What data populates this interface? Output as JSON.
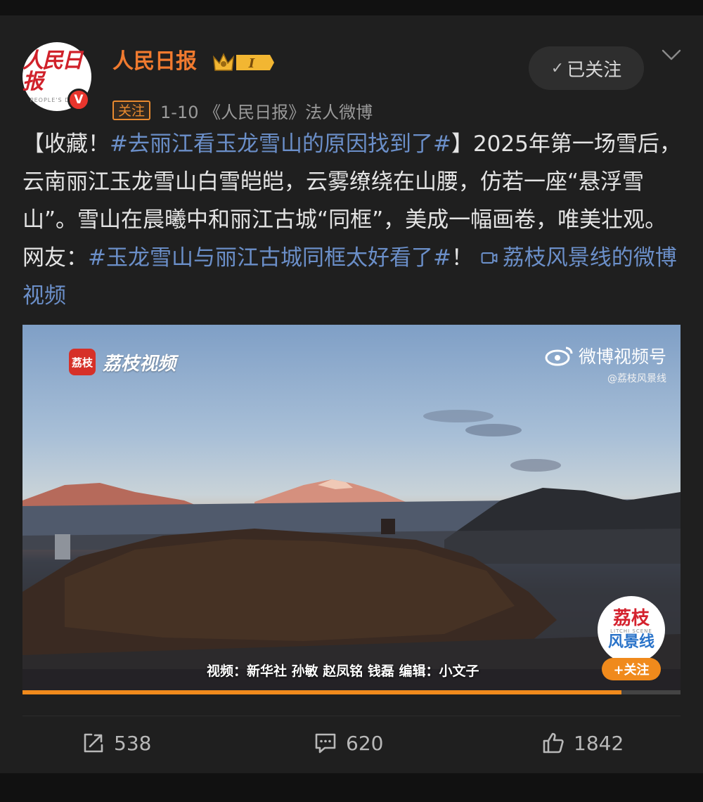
{
  "author": {
    "name": "人民日报",
    "avatar_logo": "人民日报",
    "avatar_subtitle": "PEOPLE'S DAILY",
    "verified_mark": "V",
    "level_badge": "I",
    "follow_tag": "关注",
    "meta": "1-10 《人民日报》法人微博"
  },
  "header": {
    "followed_label": "已关注",
    "followed_check": "✓"
  },
  "post": {
    "prefix": "【收藏！",
    "topic1": "#去丽江看玉龙雪山的原因找到了#",
    "body": "】2025年第一场雪后，云南丽江玉龙雪山白雪皑皑，云雾缭绕在山腰，仿若一座“悬浮雪山”。雪山在晨曦中和丽江古城“同框”，美成一幅画卷，唯美壮观。 网友：",
    "topic2": "#玉龙雪山与丽江古城同框太好看了#",
    "suffix": "！ ",
    "video_link": "荔枝风景线的微博视频"
  },
  "video": {
    "brand_icon_text": "荔枝",
    "brand_name": "荔枝视频",
    "watermark_title": "微博视频号",
    "watermark_sub": "@荔枝风景线",
    "caption": "视频：新华社 孙敏 赵凤铭 钱磊 编辑：小文子",
    "badge_line1": "荔枝",
    "badge_line2": "LITCHI SCENE",
    "badge_line3": "风景线",
    "follow_label": "+关注",
    "progress": 0.91
  },
  "actions": {
    "repost_count": "538",
    "comment_count": "620",
    "like_count": "1842"
  },
  "colors": {
    "accent_orange": "#f07a2f",
    "topic_blue": "#6b8fc9",
    "background": "#1f1f1f"
  }
}
